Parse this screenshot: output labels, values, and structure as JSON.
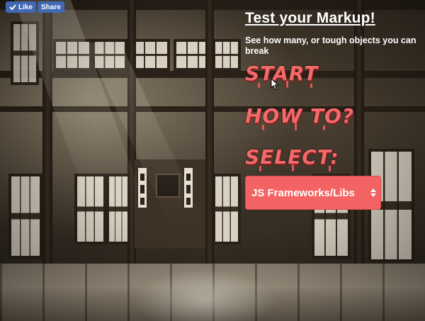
{
  "fb": {
    "like_label": "Like",
    "share_label": "Share"
  },
  "menu": {
    "title": "Test your Markup!",
    "subtitle": "See how many, or tough objects you can break",
    "start_label": "START",
    "howto_label": "HOW TO?",
    "select_label": "SELECT:",
    "dropdown": {
      "selected": "JS Frameworks/Libs"
    }
  },
  "colors": {
    "accent": "#f26a6a",
    "fb_blue": "#4267b2",
    "dropdown_bg": "#f46363"
  }
}
